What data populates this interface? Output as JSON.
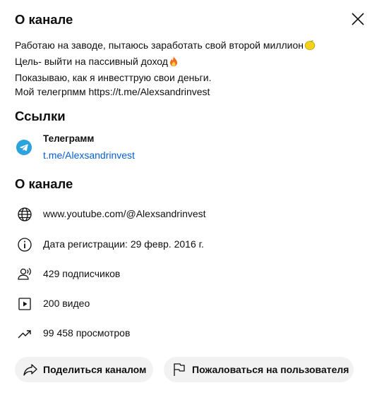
{
  "dialog": {
    "title": "О канале",
    "close_label": "Закрыть"
  },
  "description": {
    "lines": [
      "Работаю на заводе, пытаюсь заработать свой второй миллион",
      "Цель- выйти на пассивный доход",
      "Показываю, как я инвесттрую свои деньги.",
      "Мой телегрпмм https://t.me/Alexsandrinvest"
    ],
    "emojis": [
      "lemon-emoji",
      "fire-emoji"
    ]
  },
  "links": {
    "title": "Ссылки",
    "items": [
      {
        "name": "Телеграмм",
        "url": "t.me/Alexsandrinvest",
        "icon": "telegram-icon"
      }
    ]
  },
  "about": {
    "title": "О канале",
    "rows": [
      {
        "icon": "globe-icon",
        "text": "www.youtube.com/@Alexsandrinvest"
      },
      {
        "icon": "info-icon",
        "text": "Дата регистрации: 29 февр. 2016 г."
      },
      {
        "icon": "subscribers-icon",
        "text": "429 подписчиков"
      },
      {
        "icon": "video-icon",
        "text": "200 видео"
      },
      {
        "icon": "trending-icon",
        "text": "99 458 просмотров"
      }
    ]
  },
  "actions": {
    "share_label": "Поделиться каналом",
    "report_label": "Пожаловаться на пользователя"
  },
  "colors": {
    "text": "#0f0f0f",
    "link": "#065fd4",
    "button_bg": "#f2f2f2",
    "telegram": "#2aa3df"
  }
}
